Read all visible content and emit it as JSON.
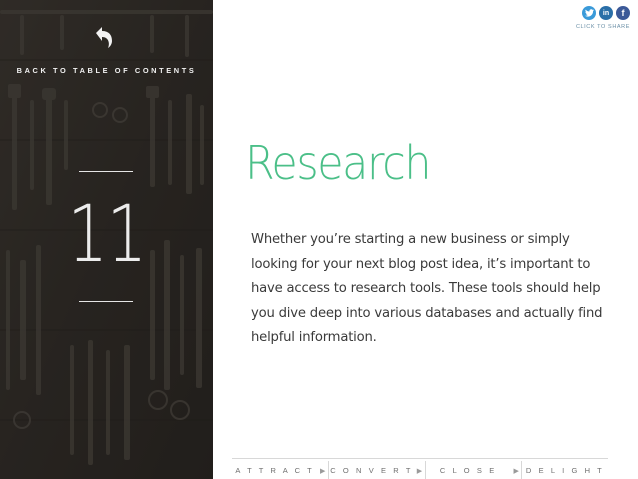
{
  "sidebar": {
    "back_label": "BACK TO TABLE OF CONTENTS",
    "chapter_number": "11",
    "back_icon": "back-arrow-icon"
  },
  "share": {
    "label": "CLICK TO SHARE",
    "icons": [
      {
        "name": "twitter-icon",
        "glyph": "t",
        "color": "#3a9ad9"
      },
      {
        "name": "linkedin-icon",
        "glyph": "in",
        "color": "#2a6fa8"
      },
      {
        "name": "facebook-icon",
        "glyph": "f",
        "color": "#3b5998"
      }
    ]
  },
  "content": {
    "title": "Research",
    "body": "Whether you’re starting a new business or simply looking for your next blog post idea, it’s important to have access to research tools. These tools should help you dive deep into various databases and actually find helpful information."
  },
  "nav": {
    "items": [
      "A T T R A C T",
      "C O N V E R T",
      "C L O S E",
      "D E L I G H T"
    ]
  },
  "colors": {
    "accent": "#4bbf88",
    "sidebar": "#2e2b27"
  }
}
